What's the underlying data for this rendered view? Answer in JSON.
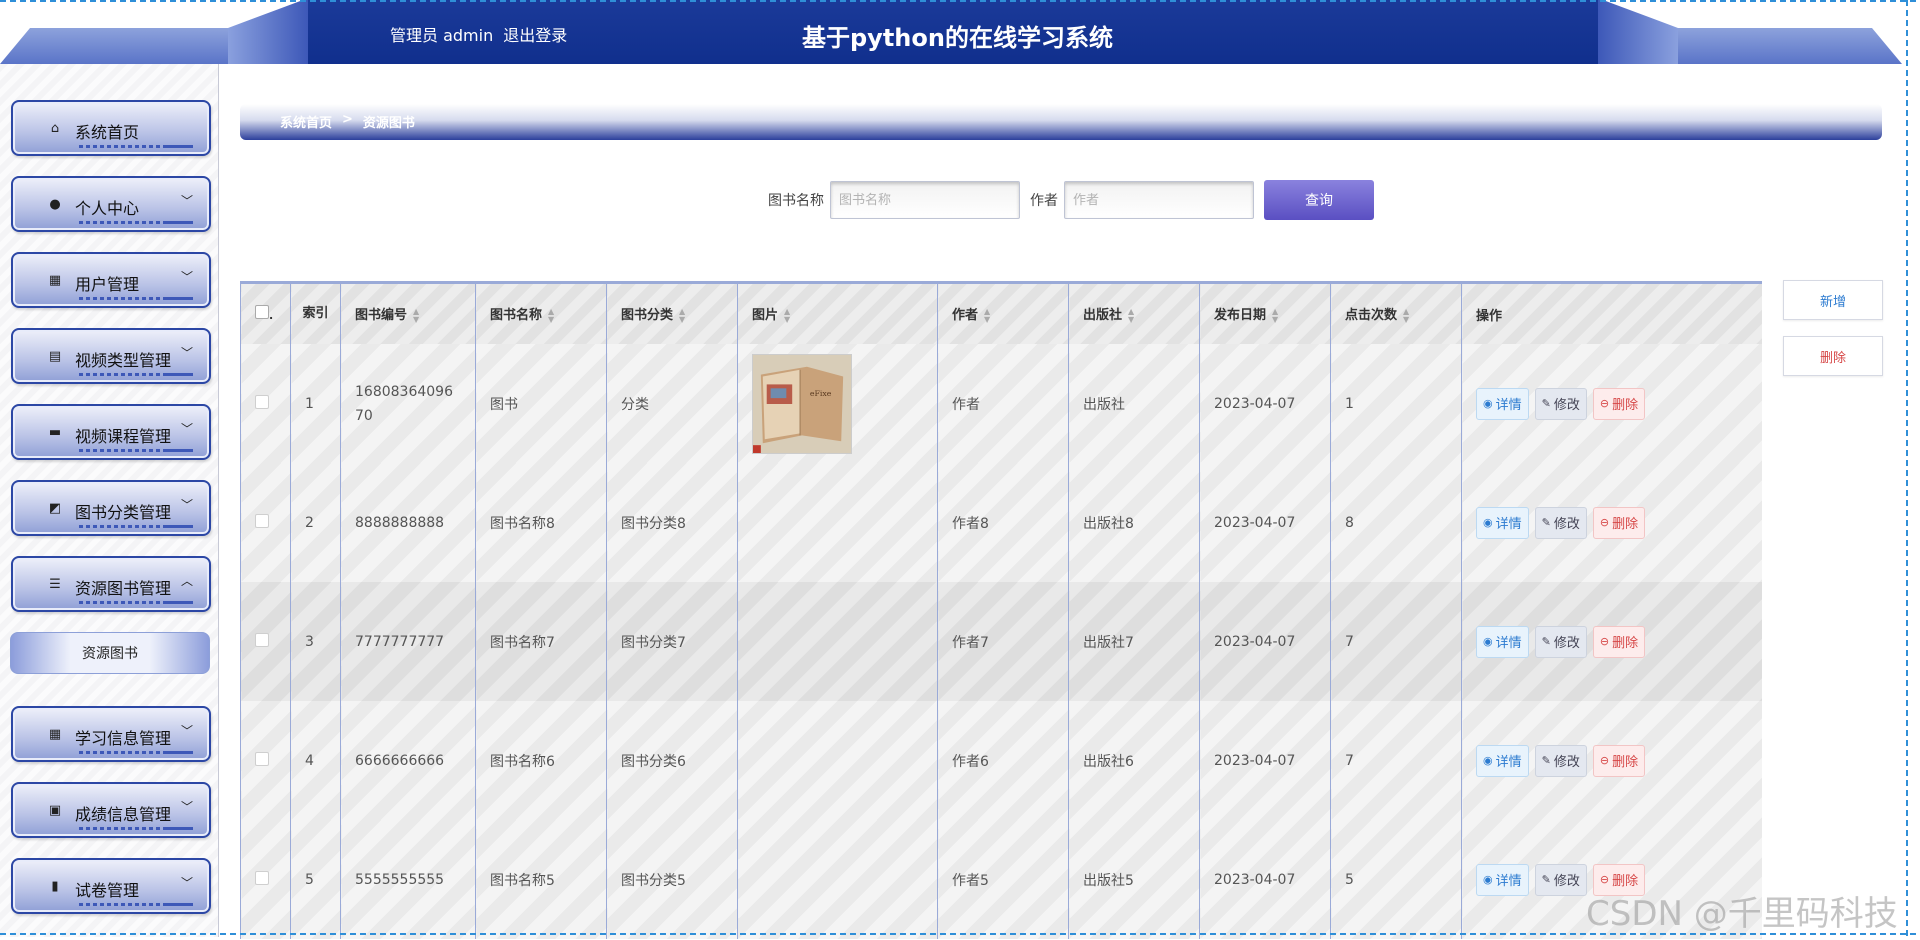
{
  "header": {
    "user_text": "管理员 admin",
    "logout_label": "退出登录",
    "title": "基于python的在线学习系统"
  },
  "sidebar": {
    "items": [
      {
        "label": "系统首页",
        "icon": "home-icon",
        "chevron": ""
      },
      {
        "label": "个人中心",
        "icon": "user-icon",
        "chevron": "﹀"
      },
      {
        "label": "用户管理",
        "icon": "grid-icon",
        "chevron": "﹀"
      },
      {
        "label": "视频类型管理",
        "icon": "clipboard-icon",
        "chevron": "﹀"
      },
      {
        "label": "视频课程管理",
        "icon": "monitor-icon",
        "chevron": "﹀"
      },
      {
        "label": "图书分类管理",
        "icon": "chart-icon",
        "chevron": "﹀"
      },
      {
        "label": "资源图书管理",
        "icon": "list-icon",
        "chevron": "︿"
      },
      {
        "label": "学习信息管理",
        "icon": "grid-icon",
        "chevron": "﹀"
      },
      {
        "label": "成绩信息管理",
        "icon": "clipboard-check-icon",
        "chevron": "﹀"
      },
      {
        "label": "试卷管理",
        "icon": "bar-chart-icon",
        "chevron": "﹀"
      }
    ],
    "submenu_label": "资源图书"
  },
  "breadcrumb": {
    "home": "系统首页",
    "separator": ">",
    "current": "资源图书"
  },
  "search": {
    "name_label": "图书名称",
    "name_placeholder": "图书名称",
    "name_value": "",
    "author_label": "作者",
    "author_placeholder": "作者",
    "author_value": "",
    "button_label": "查询"
  },
  "actions": {
    "add_label": "新增",
    "delete_label": "删除"
  },
  "table": {
    "headers": [
      "索引",
      "图书编号",
      "图书名称",
      "图书分类",
      "图片",
      "作者",
      "出版社",
      "发布日期",
      "点击次数",
      "操作"
    ],
    "rows": [
      {
        "index": "1",
        "code": "1680836409670",
        "name": "图书",
        "category": "分类",
        "image": "book-photo",
        "author": "作者",
        "publisher": "出版社",
        "date": "2023-04-07",
        "clicks": "1"
      },
      {
        "index": "2",
        "code": "8888888888",
        "name": "图书名称8",
        "category": "图书分类8",
        "image": "",
        "author": "作者8",
        "publisher": "出版社8",
        "date": "2023-04-07",
        "clicks": "8"
      },
      {
        "index": "3",
        "code": "7777777777",
        "name": "图书名称7",
        "category": "图书分类7",
        "image": "",
        "author": "作者7",
        "publisher": "出版社7",
        "date": "2023-04-07",
        "clicks": "7"
      },
      {
        "index": "4",
        "code": "6666666666",
        "name": "图书名称6",
        "category": "图书分类6",
        "image": "",
        "author": "作者6",
        "publisher": "出版社6",
        "date": "2023-04-07",
        "clicks": "7"
      },
      {
        "index": "5",
        "code": "5555555555",
        "name": "图书名称5",
        "category": "图书分类5",
        "image": "",
        "author": "作者5",
        "publisher": "出版社5",
        "date": "2023-04-07",
        "clicks": "5"
      }
    ],
    "op_detail": "详情",
    "op_edit": "修改",
    "op_delete": "删除"
  },
  "watermark": "CSDN @千里码科技",
  "colors": {
    "header_blue": "#102f8d",
    "menu_border": "#2c47a5",
    "search_button": "#5a4fc2",
    "delete_red": "#d64545",
    "detail_blue": "#2c7bd0"
  }
}
